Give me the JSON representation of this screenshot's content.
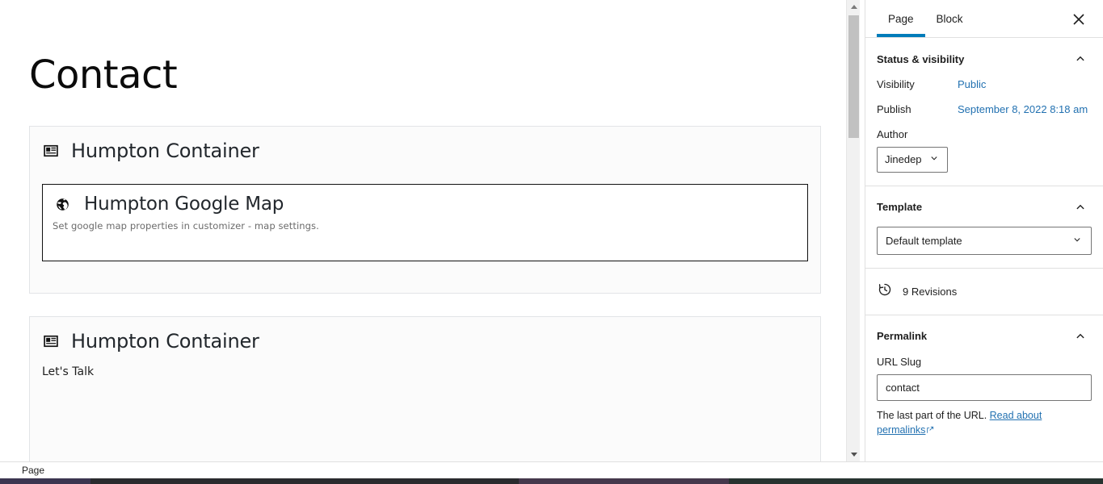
{
  "editor": {
    "post_title": "Contact",
    "blocks": [
      {
        "icon": "media-text-icon",
        "title": "Humpton Container",
        "inner": {
          "icon": "globe-icon",
          "title": "Humpton Google Map",
          "note": "Set google map properties in customizer - map settings."
        }
      },
      {
        "icon": "media-text-icon",
        "title": "Humpton Container",
        "paragraph": "Let's Talk"
      }
    ]
  },
  "sidebar": {
    "tabs": [
      {
        "label": "Page",
        "active": true
      },
      {
        "label": "Block",
        "active": false
      }
    ],
    "close_icon": "close-icon",
    "panels": {
      "status": {
        "title": "Status & visibility",
        "chevron": "chevron-up-icon",
        "visibility_label": "Visibility",
        "visibility_value": "Public",
        "publish_label": "Publish",
        "publish_value": "September 8, 2022 8:18 am",
        "author_label": "Author",
        "author_value": "Jinedep"
      },
      "template": {
        "title": "Template",
        "chevron": "chevron-up-icon",
        "selected": "Default template"
      },
      "revisions": {
        "icon": "revisions-clock-icon",
        "label": "9 Revisions"
      },
      "permalink": {
        "title": "Permalink",
        "chevron": "chevron-up-icon",
        "slug_label": "URL Slug",
        "slug_value": "contact",
        "help_prefix": "The last part of the URL. ",
        "help_link": "Read about permalinks"
      }
    }
  },
  "bottom_bar": {
    "breadcrumb": "Page"
  },
  "colors": {
    "accent": "#007cba",
    "link": "#2271b1",
    "text": "#1e1e1e",
    "panel_border": "#e0e0e0",
    "block_bg": "#fbfbfb"
  }
}
